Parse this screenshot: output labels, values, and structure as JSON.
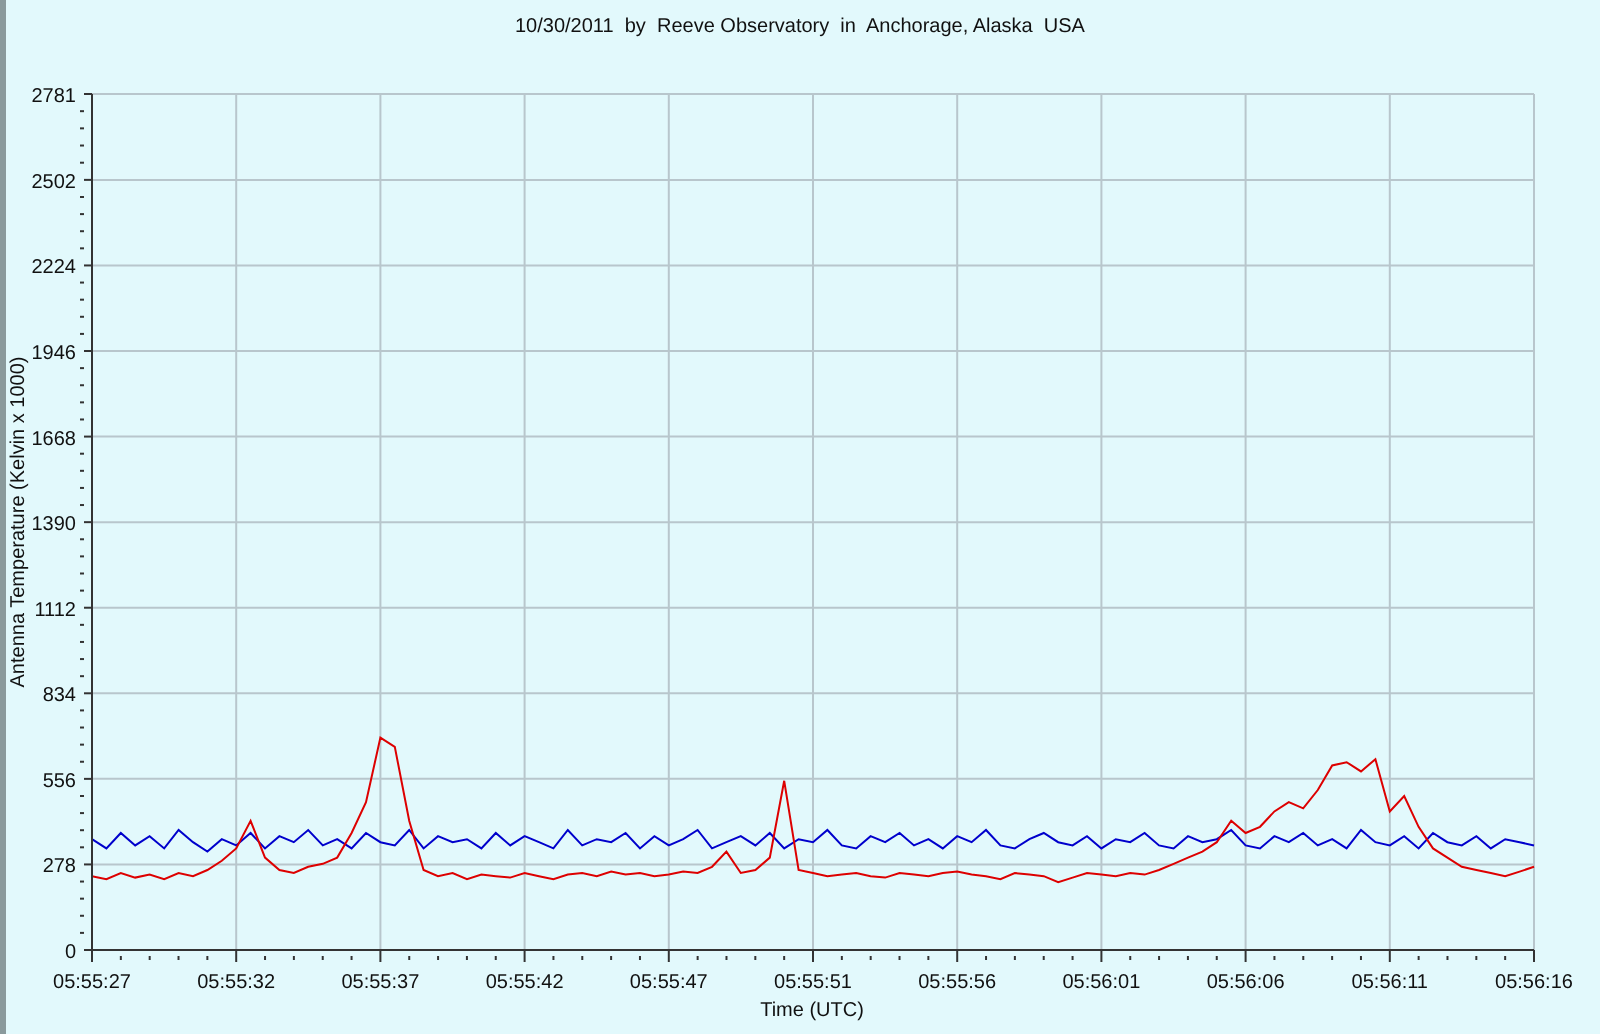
{
  "chart": {
    "chart_data": {
      "type": "line",
      "title": "10/30/2011  by  Reeve Observatory  in  Anchorage, Alaska  USA",
      "xlabel": "Time (UTC)",
      "ylabel": "Antenna Temperature (Kelvin x 1000)",
      "categories": [
        "05:55:27",
        null,
        null,
        null,
        null,
        null,
        null,
        null,
        null,
        null,
        "05:55:32",
        null,
        null,
        null,
        null,
        null,
        null,
        null,
        null,
        null,
        "05:55:37",
        null,
        null,
        null,
        null,
        null,
        null,
        null,
        null,
        null,
        "05:55:42",
        null,
        null,
        null,
        null,
        null,
        null,
        null,
        null,
        null,
        "05:55:47",
        null,
        null,
        null,
        null,
        null,
        null,
        null,
        null,
        null,
        "05:55:51",
        null,
        null,
        null,
        null,
        null,
        null,
        null,
        null,
        null,
        "05:55:56",
        null,
        null,
        null,
        null,
        null,
        null,
        null,
        null,
        null,
        "05:56:01",
        null,
        null,
        null,
        null,
        null,
        null,
        null,
        null,
        null,
        "05:56:06",
        null,
        null,
        null,
        null,
        null,
        null,
        null,
        null,
        null,
        "05:56:11",
        null,
        null,
        null,
        null,
        null,
        null,
        null,
        null,
        null,
        "05:56:16"
      ],
      "grid": true,
      "ylim": [
        0,
        2781
      ],
      "yticks": [
        0,
        278,
        556,
        834,
        1112,
        1390,
        1668,
        1946,
        2224,
        2502,
        2781
      ],
      "series": [
        {
          "color": "#0000cc",
          "values": [
            360,
            330,
            380,
            340,
            370,
            330,
            390,
            350,
            320,
            360,
            340,
            380,
            330,
            370,
            350,
            390,
            340,
            360,
            330,
            380,
            350,
            340,
            390,
            330,
            370,
            350,
            360,
            330,
            380,
            340,
            370,
            350,
            330,
            390,
            340,
            360,
            350,
            380,
            330,
            370,
            340,
            360,
            390,
            330,
            350,
            370,
            340,
            380,
            330,
            360,
            350,
            390,
            340,
            330,
            370,
            350,
            380,
            340,
            360,
            330,
            370,
            350,
            390,
            340,
            330,
            360,
            380,
            350,
            340,
            370,
            330,
            360,
            350,
            380,
            340,
            330,
            370,
            350,
            360,
            390,
            340,
            330,
            370,
            350,
            380,
            340,
            360,
            330,
            390,
            350,
            340,
            370,
            330,
            380,
            350,
            340,
            370,
            330,
            360,
            350,
            340
          ]
        },
        {
          "color": "#dd0000",
          "values": [
            240,
            230,
            250,
            235,
            245,
            230,
            250,
            240,
            260,
            290,
            330,
            420,
            300,
            260,
            250,
            270,
            280,
            300,
            380,
            480,
            690,
            660,
            420,
            260,
            240,
            250,
            230,
            245,
            240,
            235,
            250,
            240,
            230,
            245,
            250,
            240,
            255,
            245,
            250,
            240,
            245,
            255,
            250,
            270,
            320,
            250,
            260,
            300,
            550,
            260,
            250,
            240,
            245,
            250,
            240,
            235,
            250,
            245,
            240,
            250,
            255,
            245,
            240,
            230,
            250,
            245,
            240,
            220,
            235,
            250,
            245,
            240,
            250,
            245,
            260,
            280,
            300,
            320,
            350,
            420,
            380,
            400,
            450,
            480,
            460,
            520,
            600,
            610,
            580,
            620,
            450,
            500,
            400,
            330,
            300,
            270,
            260,
            250,
            240,
            255,
            270
          ]
        }
      ]
    }
  }
}
